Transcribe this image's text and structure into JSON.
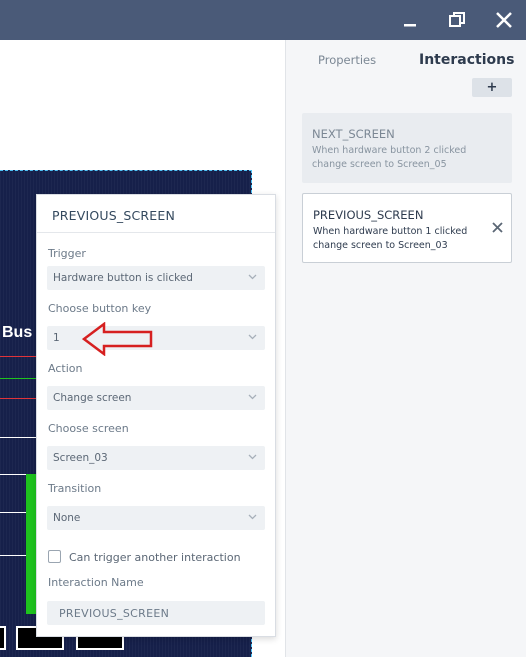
{
  "window": {
    "minimize_icon": "minimize-icon",
    "restore_icon": "restore-icon",
    "close_icon": "close-icon"
  },
  "preview": {
    "title": "Bus"
  },
  "popup": {
    "title": "PREVIOUS_SCREEN",
    "trigger_label": "Trigger",
    "trigger_value": "Hardware button is clicked",
    "button_key_label": "Choose button key",
    "button_key_value": "1",
    "action_label": "Action",
    "action_value": "Change screen",
    "screen_label": "Choose screen",
    "screen_value": "Screen_03",
    "transition_label": "Transition",
    "transition_value": "None",
    "can_trigger_label": "Can trigger another interaction",
    "can_trigger_checked": false,
    "name_label": "Interaction Name",
    "name_value": "PREVIOUS_SCREEN"
  },
  "panel": {
    "tabs": [
      {
        "label": "Properties"
      },
      {
        "label": "Interactions"
      }
    ],
    "add_label": "+",
    "interactions": [
      {
        "name": "NEXT_SCREEN",
        "line1": "When hardware button 2 clicked",
        "line2": "change screen to Screen_05"
      },
      {
        "name": "PREVIOUS_SCREEN",
        "line1": "When hardware button 1 clicked",
        "line2": "change screen to Screen_03"
      }
    ]
  },
  "colors": {
    "titlebar": "#4a5a78",
    "annotation_arrow": "#d62020",
    "preview_bg": "#16204a",
    "green": "#1ec31e"
  }
}
